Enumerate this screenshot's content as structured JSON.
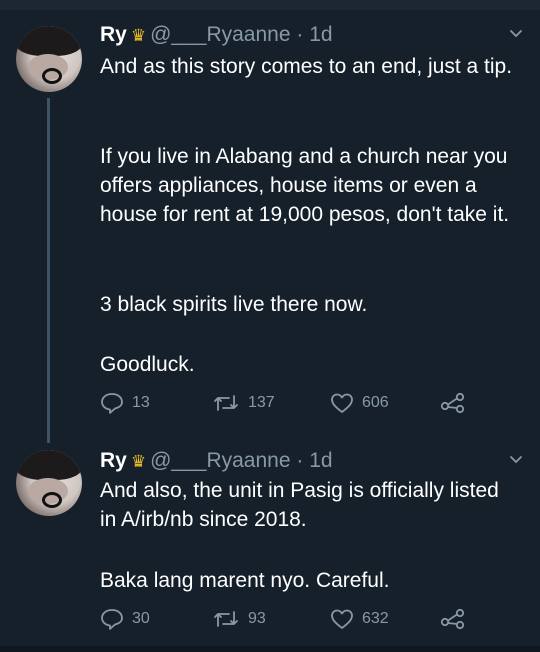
{
  "tweets": [
    {
      "name": "Ry",
      "crown_icon": "crown-icon",
      "handle": "@___Ryaanne",
      "separator": "·",
      "time": "1d",
      "body": {
        "line1": "And as this story comes to an end, just a tip.",
        "line2": "If you live in Alabang and a church near you offers appliances, house items or even a house for rent at 19,000 pesos, don't take it.",
        "line3": "3 black spirits live there now.",
        "line4": "Goodluck."
      },
      "replies": "13",
      "retweets": "137",
      "likes": "606"
    },
    {
      "name": "Ry",
      "crown_icon": "crown-icon",
      "handle": "@___Ryaanne",
      "separator": "·",
      "time": "1d",
      "body": {
        "line1": "And also, the unit in Pasig is officially listed in A/irb/nb since 2018.",
        "line2": "Baka lang marent nyo. Careful."
      },
      "replies": "30",
      "retweets": "93",
      "likes": "632"
    }
  ],
  "colors": {
    "background": "#15202b",
    "secondary_text": "#8899a6",
    "thread_line": "#3d5466",
    "crown": "#e8b923"
  }
}
